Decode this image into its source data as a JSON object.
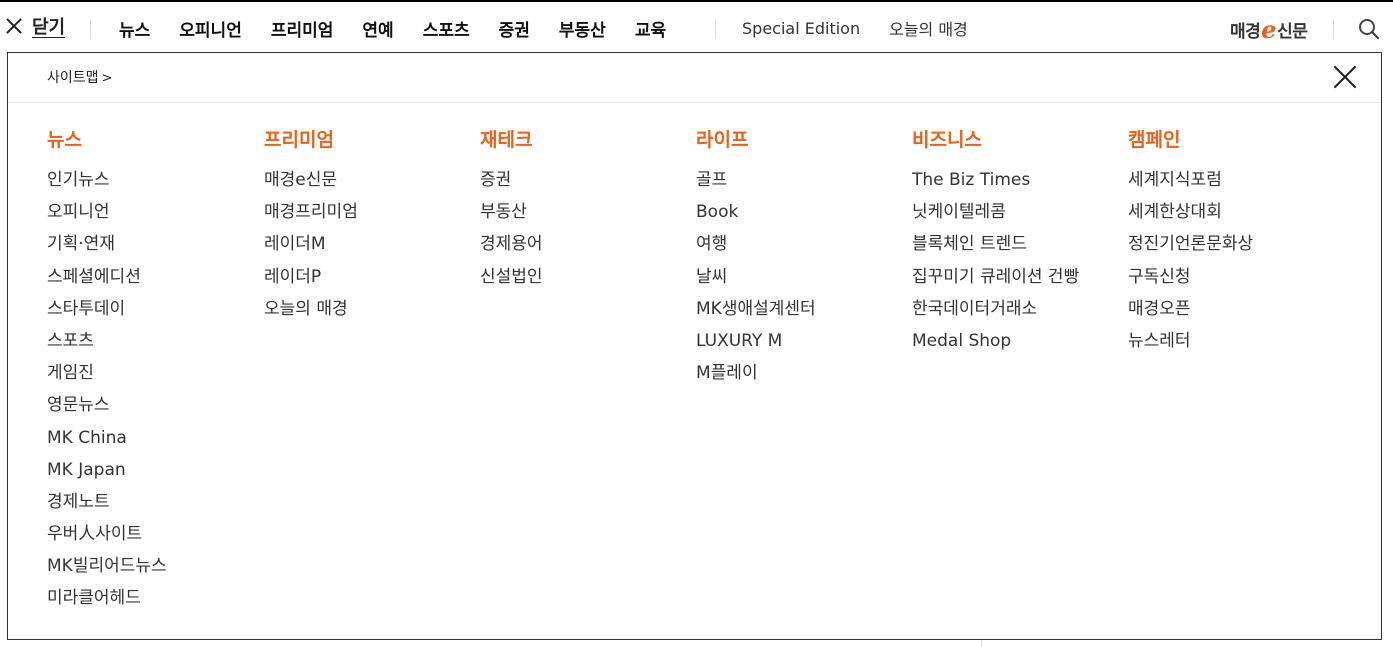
{
  "topbar": {
    "close_label": "닫기",
    "main_nav": [
      "뉴스",
      "오피니언",
      "프리미엄",
      "연예",
      "스포츠",
      "증권",
      "부동산",
      "교육"
    ],
    "sub_nav": [
      "Special Edition",
      "오늘의 매경"
    ],
    "logo": {
      "prefix": "매경",
      "e": "e",
      "suffix": "신문"
    }
  },
  "sitemap": {
    "link_label": "사이트맵",
    "link_chevron": ">",
    "columns": [
      {
        "heading": "뉴스",
        "items": [
          "인기뉴스",
          "오피니언",
          "기획·연재",
          "스페셜에디션",
          "스타투데이",
          "스포츠",
          "게임진",
          "영문뉴스",
          "MK China",
          "MK Japan",
          "경제노트",
          "우버人사이트",
          "MK빌리어드뉴스",
          "미라클어헤드"
        ]
      },
      {
        "heading": "프리미엄",
        "items": [
          "매경e신문",
          "매경프리미엄",
          "레이더M",
          "레이더P",
          "오늘의 매경"
        ]
      },
      {
        "heading": "재테크",
        "items": [
          "증권",
          "부동산",
          "경제용어",
          "신설법인"
        ]
      },
      {
        "heading": "라이프",
        "items": [
          "골프",
          "Book",
          "여행",
          "날씨",
          "MK생애설계센터",
          "LUXURY M",
          "M플레이"
        ]
      },
      {
        "heading": "비즈니스",
        "items": [
          "The Biz Times",
          "닛케이텔레콤",
          "블록체인 트렌드",
          "집꾸미기 큐레이션 건빵",
          "한국데이터거래소",
          "Medal Shop"
        ]
      },
      {
        "heading": "캠페인",
        "items": [
          "세계지식포럼",
          "세계한상대회",
          "정진기언론문화상",
          "구독신청",
          "매경오픈",
          "뉴스레터"
        ]
      }
    ]
  },
  "colors": {
    "accent": "#e8611d",
    "text": "#333333"
  },
  "icons": {
    "close": "close-icon",
    "search": "search-icon",
    "chevron": "chevron-right-icon"
  }
}
